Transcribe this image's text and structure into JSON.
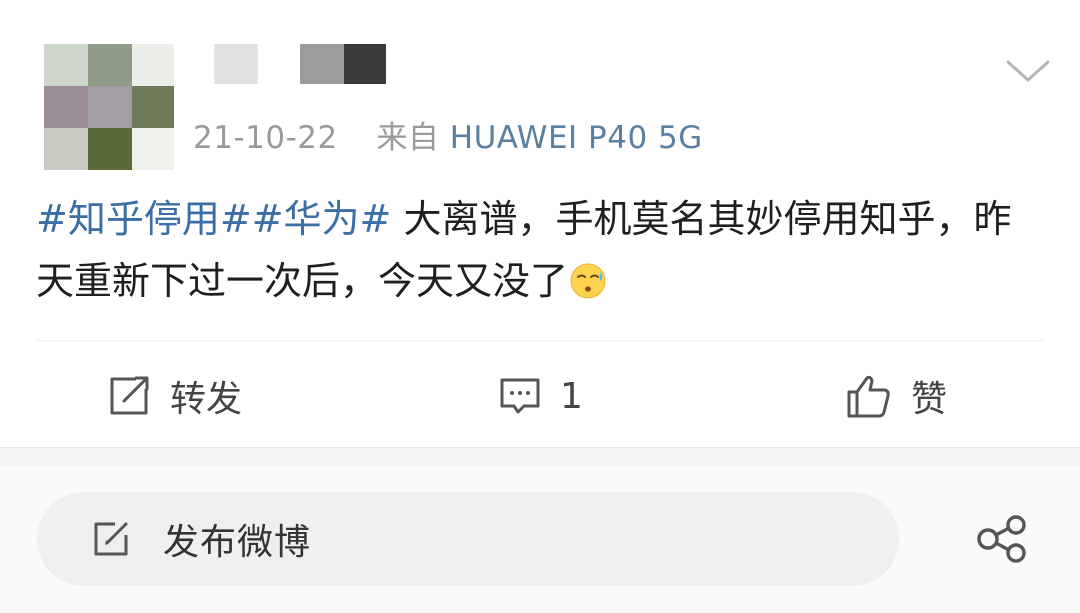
{
  "post": {
    "meta": {
      "date": "21-10-22",
      "source_prefix": "来自",
      "device": "HUAWEI P40 5G"
    },
    "content": {
      "tag1": "#知乎停用#",
      "tag2": "#华为#",
      "text": " 大离谱，手机莫名其妙停用知乎，昨天重新下过一次后，今天又没了",
      "emoji": "sleepy-sweat-emoji"
    },
    "actions": {
      "repost_label": "转发",
      "comment_count": "1",
      "like_label": "赞"
    }
  },
  "bottom_bar": {
    "compose_label": "发布微博"
  },
  "colors": {
    "tag": "#3a6ea5",
    "meta_gray": "#999999",
    "device": "#5b7fa3"
  }
}
